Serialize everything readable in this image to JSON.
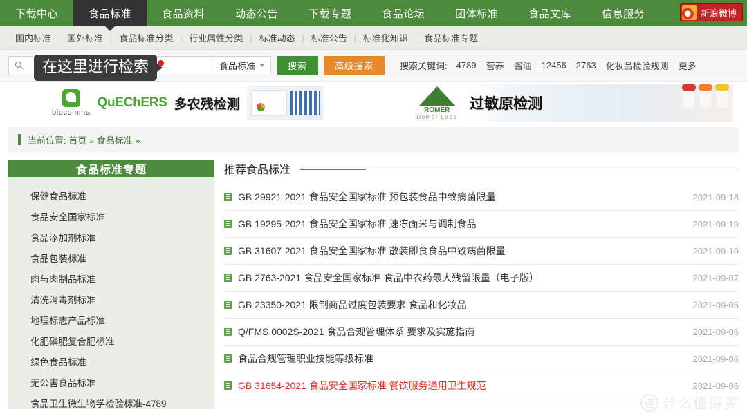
{
  "site": {
    "nav": {
      "items": [
        {
          "label": "下载中心",
          "active": false
        },
        {
          "label": "食品标准",
          "active": true
        },
        {
          "label": "食品资料",
          "active": false
        },
        {
          "label": "动态公告",
          "active": false
        },
        {
          "label": "下载专题",
          "active": false
        },
        {
          "label": "食品论坛",
          "active": false
        },
        {
          "label": "团体标准",
          "active": false
        },
        {
          "label": "食品文库",
          "active": false
        },
        {
          "label": "信息服务",
          "active": false
        }
      ],
      "weibo_label": "新浪微博"
    },
    "subnav": {
      "items": [
        "国内标准",
        "国外标准",
        "食品标准分类",
        "行业属性分类",
        "标准动态",
        "标准公告",
        "标准化知识",
        "食品标准专题"
      ],
      "separator": "|"
    },
    "search": {
      "input_value": "",
      "placeholder": "",
      "category_selected": "食品标准",
      "search_button": "搜索",
      "advanced_button": "高级搜索",
      "tooltip": "在这里进行检索",
      "keywords_label": "搜索关键词:",
      "keywords": [
        "4789",
        "营养",
        "酱油",
        "12456",
        "2763",
        "化妆品检验规则",
        "更多"
      ]
    },
    "banners": {
      "left": {
        "brand": "biocomma",
        "title_en": "QuEChERS",
        "title_cn": "多农残检测"
      },
      "right": {
        "brand": "ROMER",
        "brand_sub": "Romer Labs",
        "title_cn": "过敏原检测"
      }
    },
    "breadcrumb": {
      "prefix": "当前位置:",
      "items": [
        "首页",
        "食品标准"
      ],
      "separator": "»"
    },
    "sidebar": {
      "title": "食品标准专题",
      "items": [
        "保健食品标准",
        "食品安全国家标准",
        "食品添加剂标准",
        "食品包装标准",
        "肉与肉制品标准",
        "清洗消毒剂标准",
        "地理标志产品标准",
        "化肥磷肥复合肥标准",
        "绿色食品标准",
        "无公害食品标准",
        "食品卫生微生物学检验标准-4789"
      ]
    },
    "content": {
      "section_title": "推荐食品标准",
      "documents": [
        {
          "title": "GB 29921-2021 食品安全国家标准 预包装食品中致病菌限量",
          "date": "2021-09-18",
          "highlight": false
        },
        {
          "title": "GB 19295-2021 食品安全国家标准 速冻面米与调制食品",
          "date": "2021-09-19",
          "highlight": false
        },
        {
          "title": "GB 31607-2021 食品安全国家标准 散装即食食品中致病菌限量",
          "date": "2021-09-19",
          "highlight": false
        },
        {
          "title": "GB 2763-2021 食品安全国家标准 食品中农药最大残留限量（电子版）",
          "date": "2021-09-07",
          "highlight": false
        },
        {
          "title": "GB 23350-2021 限制商品过度包装要求 食品和化妆品",
          "date": "2021-09-06",
          "highlight": false
        },
        {
          "title": "Q/FMS 0002S-2021 食品合规管理体系 要求及实施指南",
          "date": "2021-09-06",
          "highlight": false
        },
        {
          "title": "食品合规管理职业技能等级标准",
          "date": "2021-09-06",
          "highlight": false
        },
        {
          "title": "GB 31654-2021 食品安全国家标准 餐饮服务通用卫生规范",
          "date": "2021-09-06",
          "highlight": true
        }
      ]
    },
    "watermark": {
      "mark": "值",
      "text": "什么值得买"
    },
    "colors": {
      "nav_green": "#4b8b3b",
      "active_tab": "#333333",
      "search_button": "#3f8f33",
      "advanced_button": "#e58a2a",
      "sidebar_bg": "#eaeee6",
      "highlight_red": "#e03022",
      "weibo_red": "#c32222"
    }
  }
}
